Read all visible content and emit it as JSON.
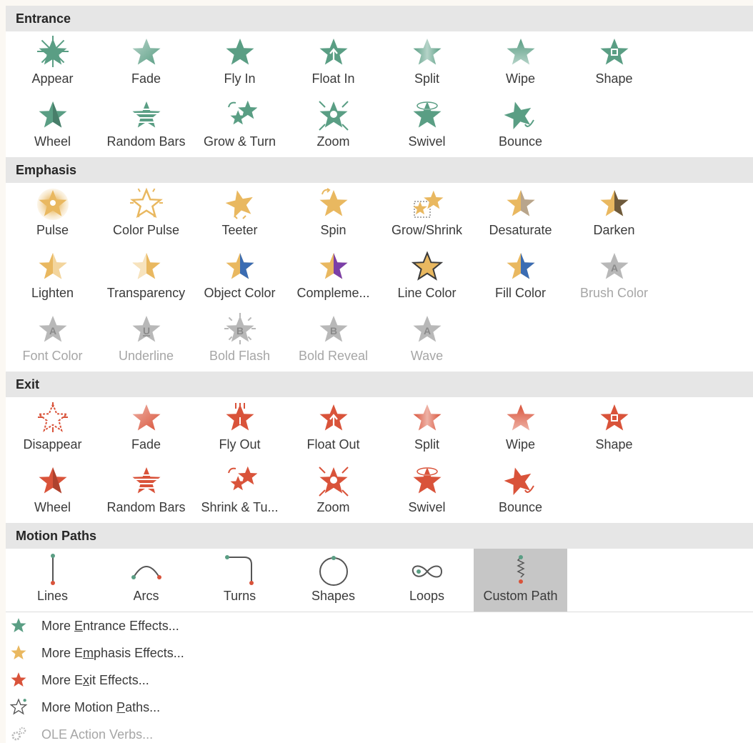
{
  "colors": {
    "entrance": "#5a9e84",
    "emphasis": "#e9b860",
    "exit": "#d9533a",
    "disabled": "#b8b8b8",
    "selected_bg": "#c6c6c6",
    "header_bg": "#e6e6e6"
  },
  "sections": {
    "entrance": {
      "title": "Entrance",
      "items": [
        {
          "label": "Appear",
          "icon": "appear-star-icon"
        },
        {
          "label": "Fade",
          "icon": "fade-star-icon"
        },
        {
          "label": "Fly In",
          "icon": "fly-in-star-icon"
        },
        {
          "label": "Float In",
          "icon": "float-in-star-icon"
        },
        {
          "label": "Split",
          "icon": "split-star-icon"
        },
        {
          "label": "Wipe",
          "icon": "wipe-star-icon"
        },
        {
          "label": "Shape",
          "icon": "shape-star-icon"
        },
        {
          "label": "Wheel",
          "icon": "wheel-star-icon"
        },
        {
          "label": "Random Bars",
          "icon": "random-bars-star-icon"
        },
        {
          "label": "Grow & Turn",
          "icon": "grow-turn-star-icon"
        },
        {
          "label": "Zoom",
          "icon": "zoom-star-icon"
        },
        {
          "label": "Swivel",
          "icon": "swivel-star-icon"
        },
        {
          "label": "Bounce",
          "icon": "bounce-star-icon"
        }
      ]
    },
    "emphasis": {
      "title": "Emphasis",
      "items": [
        {
          "label": "Pulse",
          "icon": "pulse-star-icon"
        },
        {
          "label": "Color Pulse",
          "icon": "color-pulse-star-icon"
        },
        {
          "label": "Teeter",
          "icon": "teeter-star-icon"
        },
        {
          "label": "Spin",
          "icon": "spin-star-icon"
        },
        {
          "label": "Grow/Shrink",
          "icon": "grow-shrink-star-icon"
        },
        {
          "label": "Desaturate",
          "icon": "desaturate-star-icon"
        },
        {
          "label": "Darken",
          "icon": "darken-star-icon"
        },
        {
          "label": "Lighten",
          "icon": "lighten-star-icon"
        },
        {
          "label": "Transparency",
          "icon": "transparency-star-icon"
        },
        {
          "label": "Object Color",
          "icon": "object-color-star-icon"
        },
        {
          "label": "Compleme...",
          "icon": "complementary-color-star-icon"
        },
        {
          "label": "Line Color",
          "icon": "line-color-star-icon"
        },
        {
          "label": "Fill Color",
          "icon": "fill-color-star-icon"
        },
        {
          "label": "Brush Color",
          "icon": "brush-color-star-icon",
          "disabled": true,
          "letter": "A"
        },
        {
          "label": "Font Color",
          "icon": "font-color-star-icon",
          "disabled": true,
          "letter": "A"
        },
        {
          "label": "Underline",
          "icon": "underline-star-icon",
          "disabled": true,
          "letter": "U"
        },
        {
          "label": "Bold Flash",
          "icon": "bold-flash-star-icon",
          "disabled": true,
          "letter": "B"
        },
        {
          "label": "Bold Reveal",
          "icon": "bold-reveal-star-icon",
          "disabled": true,
          "letter": "B"
        },
        {
          "label": "Wave",
          "icon": "wave-star-icon",
          "disabled": true,
          "letter": "A"
        }
      ]
    },
    "exit": {
      "title": "Exit",
      "items": [
        {
          "label": "Disappear",
          "icon": "disappear-star-icon"
        },
        {
          "label": "Fade",
          "icon": "fade-star-icon"
        },
        {
          "label": "Fly Out",
          "icon": "fly-out-star-icon"
        },
        {
          "label": "Float Out",
          "icon": "float-out-star-icon"
        },
        {
          "label": "Split",
          "icon": "split-star-icon"
        },
        {
          "label": "Wipe",
          "icon": "wipe-star-icon"
        },
        {
          "label": "Shape",
          "icon": "shape-star-icon"
        },
        {
          "label": "Wheel",
          "icon": "wheel-star-icon"
        },
        {
          "label": "Random Bars",
          "icon": "random-bars-star-icon"
        },
        {
          "label": "Shrink & Tu...",
          "icon": "shrink-turn-star-icon"
        },
        {
          "label": "Zoom",
          "icon": "zoom-star-icon"
        },
        {
          "label": "Swivel",
          "icon": "swivel-star-icon"
        },
        {
          "label": "Bounce",
          "icon": "bounce-star-icon"
        }
      ]
    },
    "motion_paths": {
      "title": "Motion Paths",
      "items": [
        {
          "label": "Lines",
          "icon": "line-path-icon"
        },
        {
          "label": "Arcs",
          "icon": "arc-path-icon"
        },
        {
          "label": "Turns",
          "icon": "turn-path-icon"
        },
        {
          "label": "Shapes",
          "icon": "circle-path-icon"
        },
        {
          "label": "Loops",
          "icon": "loop-path-icon"
        },
        {
          "label": "Custom Path",
          "icon": "custom-path-icon",
          "selected": true
        }
      ]
    }
  },
  "menu": {
    "more_entrance": {
      "pre": "More ",
      "u": "E",
      "post": "ntrance Effects...",
      "icon": "entrance-star-icon"
    },
    "more_emphasis": {
      "pre": "More E",
      "u": "m",
      "post": "phasis Effects...",
      "icon": "emphasis-star-icon"
    },
    "more_exit": {
      "pre": "More E",
      "u": "x",
      "post": "it Effects...",
      "icon": "exit-star-icon"
    },
    "more_motion": {
      "pre": "More Motion ",
      "u": "P",
      "post": "aths...",
      "icon": "motion-path-star-icon"
    },
    "ole_verbs": {
      "pre": "OLE Action Verbs...",
      "u": "",
      "post": "",
      "icon": "gears-icon",
      "disabled": true
    }
  }
}
